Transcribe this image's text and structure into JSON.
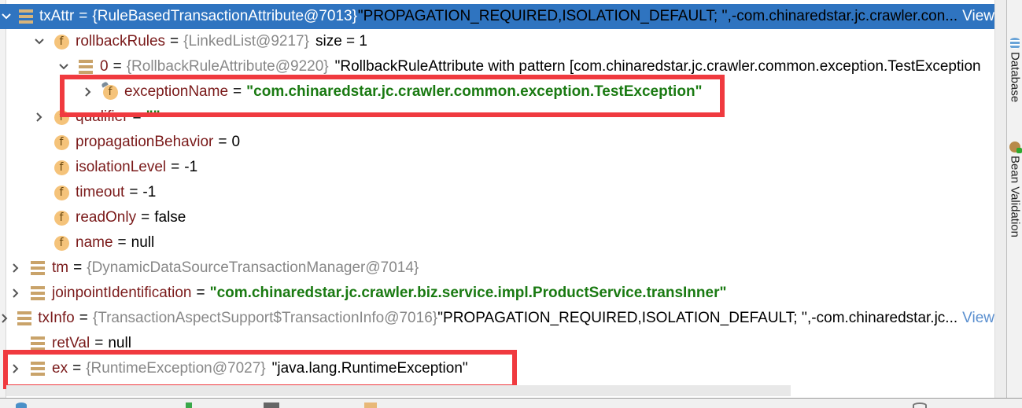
{
  "tree": {
    "rows": [
      {
        "name": "txAttr",
        "type": "{RuleBasedTransactionAttribute@7013}",
        "value": "\"PROPAGATION_REQUIRED,ISOLATION_DEFAULT; '',-com.chinaredstar.jc.crawler.con...",
        "view": "View",
        "icon": "object-icon",
        "state": "expanded",
        "selected": true
      },
      {
        "name": "rollbackRules",
        "type": "{LinkedList@9217}",
        "value": "size = 1",
        "icon": "field-icon",
        "state": "expanded"
      },
      {
        "name": "0",
        "type": "{RollbackRuleAttribute@9220}",
        "value": "\"RollbackRuleAttribute with pattern [com.chinaredstar.jc.crawler.common.exception.TestException",
        "icon": "object-icon",
        "state": "expanded"
      },
      {
        "name": "exceptionName",
        "value": "\"com.chinaredstar.jc.crawler.common.exception.TestException\"",
        "icon": "final-field-icon",
        "state": "collapsed"
      },
      {
        "name": "qualifier",
        "value": "\"\"",
        "icon": "field-icon",
        "state": "collapsed"
      },
      {
        "name": "propagationBehavior",
        "value": "0",
        "icon": "field-icon",
        "state": "leaf"
      },
      {
        "name": "isolationLevel",
        "value": "-1",
        "icon": "field-icon",
        "state": "leaf"
      },
      {
        "name": "timeout",
        "value": "-1",
        "icon": "field-icon",
        "state": "leaf"
      },
      {
        "name": "readOnly",
        "value": "false",
        "icon": "field-icon",
        "state": "leaf"
      },
      {
        "name": "name",
        "value": "null",
        "icon": "field-icon",
        "state": "leaf"
      },
      {
        "name": "tm",
        "type": "{DynamicDataSourceTransactionManager@7014}",
        "icon": "object-icon",
        "state": "collapsed"
      },
      {
        "name": "joinpointIdentification",
        "value": "\"com.chinaredstar.jc.crawler.biz.service.impl.ProductService.transInner\"",
        "icon": "object-icon",
        "state": "collapsed"
      },
      {
        "name": "txInfo",
        "type": "{TransactionAspectSupport$TransactionInfo@7016}",
        "value": "\"PROPAGATION_REQUIRED,ISOLATION_DEFAULT; '',-com.chinaredstar.jc...",
        "view": "View",
        "icon": "object-icon",
        "state": "collapsed"
      },
      {
        "name": "retVal",
        "value": "null",
        "icon": "object-icon",
        "state": "leaf"
      },
      {
        "name": "ex",
        "type": "{RuntimeException@7027}",
        "value": "\"java.lang.RuntimeException\"",
        "icon": "object-icon",
        "state": "collapsed"
      }
    ]
  },
  "side_panel": {
    "tabs": [
      {
        "label": "Database",
        "icon": "database-icon"
      },
      {
        "label": "Bean Validation",
        "icon": "bean-validation-icon"
      }
    ]
  },
  "colors": {
    "selection": "#2f74c0",
    "highlight_box": "#f03a3f",
    "string_value": "#1a7a12",
    "field_name": "#7a1a1a",
    "type_text": "#888888",
    "view_link": "#5a8fcf"
  }
}
